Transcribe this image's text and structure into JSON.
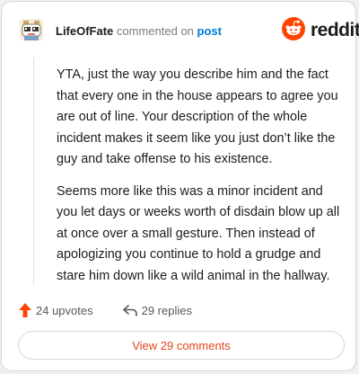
{
  "header": {
    "username": "LifeOfFate",
    "commented_text": "commented on",
    "post_link": "post",
    "avatar_icon": "snoo-avatar-icon",
    "brand": "reddit",
    "brand_icon": "reddit-snoo-icon",
    "brand_color": "#ff4500"
  },
  "comment": {
    "paragraphs": [
      "YTA, just the way you describe him and the fact that every one in the house appears to agree you are out of line. Your description of the whole incident makes it seem like you just don’t like the guy and take offense to his existence.",
      "Seems more like this was a minor incident and you let days or weeks worth of disdain blow up all at once over a small gesture. Then instead of apologizing you continue to hold a grudge and stare him down like a wild animal in the hallway."
    ]
  },
  "actions": {
    "upvotes": "24 upvotes",
    "upvote_icon": "upvote-arrow-icon",
    "upvote_color": "#ff4500",
    "replies": "29 replies",
    "reply_icon": "reply-arrow-icon"
  },
  "footer": {
    "view_comments": "View 29 comments"
  }
}
